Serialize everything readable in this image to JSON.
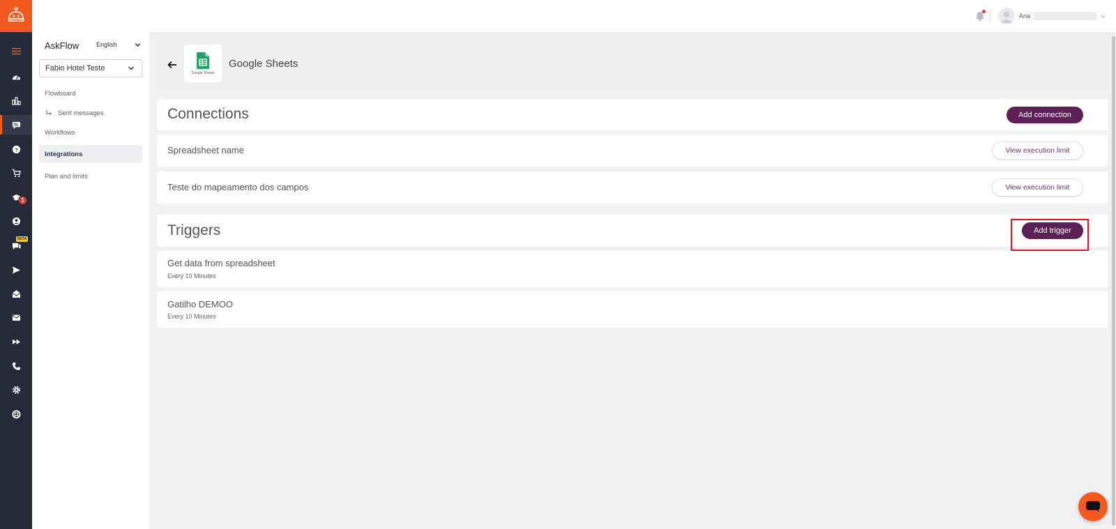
{
  "topbar": {
    "user_name": "Ana"
  },
  "sidebar": {
    "brand": "AskFlow",
    "language": "English",
    "hotel": "Fabio Hotel Teste",
    "items": [
      {
        "label": "Flowboard"
      },
      {
        "label": "Sent messages"
      },
      {
        "label": "Workflows"
      },
      {
        "label": "Integrations"
      },
      {
        "label": "Plan and limits"
      }
    ]
  },
  "rail": {
    "badge_count": "1",
    "beta_label": "BETA"
  },
  "main": {
    "app_title": "Google Sheets",
    "app_logo_caption": "Google Sheets",
    "connections": {
      "title": "Connections",
      "add_button": "Add connection",
      "items": [
        {
          "name": "Spreadsheet name",
          "action": "View execution limit"
        },
        {
          "name": "Teste do mapeamento dos campos",
          "action": "View execution limit"
        }
      ]
    },
    "triggers": {
      "title": "Triggers",
      "add_button": "Add trigger",
      "items": [
        {
          "name": "Get data from spreadsheet",
          "schedule": "Every 10 Minutes"
        },
        {
          "name": "Gatilho DEMOO",
          "schedule": "Every 10 Minutes"
        }
      ]
    }
  },
  "colors": {
    "brand_orange": "#f45a1e",
    "rail_bg": "#252a38",
    "primary_purple": "#5c1f56",
    "highlight_red": "#e8121b"
  }
}
